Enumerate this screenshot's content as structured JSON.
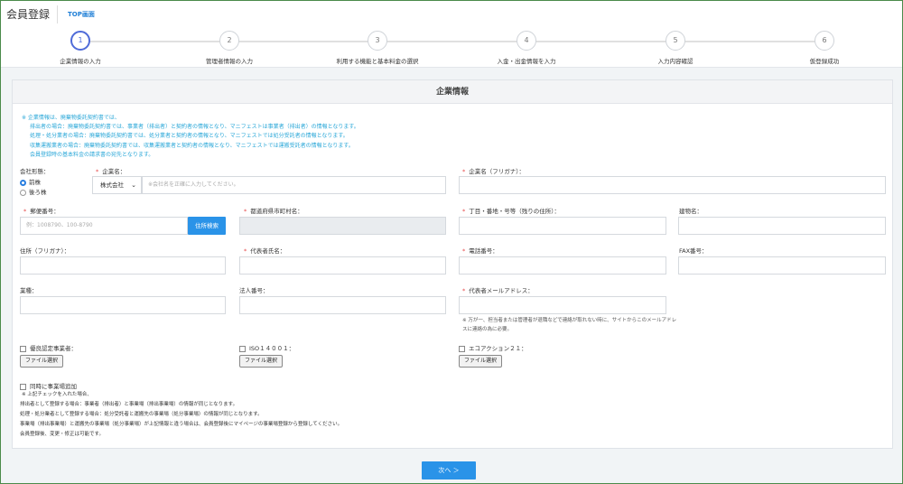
{
  "header": {
    "title": "会員登録",
    "top_link": "TOP画面"
  },
  "steps": [
    {
      "num": "1",
      "label": "企業情報の入力"
    },
    {
      "num": "2",
      "label": "管理者情報の入力"
    },
    {
      "num": "3",
      "label": "利用する機能と基本料金の選択"
    },
    {
      "num": "4",
      "label": "入金・出金情報を入力"
    },
    {
      "num": "5",
      "label": "入力内容確認"
    },
    {
      "num": "6",
      "label": "仮登録成功"
    }
  ],
  "card": {
    "title": "企業情報",
    "notice": [
      "※ 企業情報は、廃棄物委託契約書では、",
      "排出者の場合：廃棄物委託契約書では、事業者（排出者）と契約者の情報となり、マニフェストは事業者（排出者）の情報となります。",
      "処理・処分業者の場合：廃棄物委託契約書では、処分業者と契約者の情報となり、マニフェストでは処分受託者の情報となります。",
      "収集運搬業者の場合：廃棄物委託契約書では、収集運搬業者と契約者の情報となり、マニフェストでは運搬受託者の情報となります。",
      "会員登録時の基本料金の請求書の宛先となります。"
    ]
  },
  "form": {
    "company_form_label": "会社形態：",
    "radio_before": "前株",
    "radio_after": "後ろ株",
    "company_name_label": "企業名：",
    "company_type_value": "株式会社",
    "company_name_placeholder": "※会社名を正確に入力してください。",
    "company_kana_label": "企業名（フリガナ）：",
    "postal_label": "郵便番号：",
    "postal_placeholder": "例：1008790、100-8790",
    "address_search": "住所検索",
    "prefecture_label": "都道府県市町村名：",
    "street_label": "丁目・番地・号等（残りの住所）：",
    "building_label": "建物名：",
    "address_kana_label": "住所（フリガナ）：",
    "representative_label": "代表者氏名：",
    "phone_label": "電話番号：",
    "fax_label": "FAX番号：",
    "industry_label": "業種：",
    "corp_number_label": "法人番号：",
    "rep_email_label": "代表者メールアドレス：",
    "email_note": "※ 万が一、担当者または管理者が退職などで連絡が取れない時に、サイトからこのメールアドレスに連絡の為に必要。",
    "excellent_label": "優良認定事業者：",
    "iso_label": "ISO１４００１：",
    "eco_label": "エコアクション２１：",
    "file_select": "ファイル選択",
    "simultaneous_label": "同時に事業場追加",
    "sim_notes": [
      "※ 上記チェックを入れた場合、",
      "排出者として登録する場合：事業者（排出者）と事業場（排出事業場）の情報が同じとなります。",
      "処理・処分業者として登録する場合：処分受託者と運搬先の事業場（処分事業場）の情報が同じとなります。",
      "事業場（排出事業場）と運搬先の事業場（処分事業場）が上記情報と違う場合は、会員登録後にマイページの事業場登録から登録してください。",
      "会員登録後、変更・修正は可能です。"
    ]
  },
  "footer": {
    "next_label": "次へ ＞"
  }
}
